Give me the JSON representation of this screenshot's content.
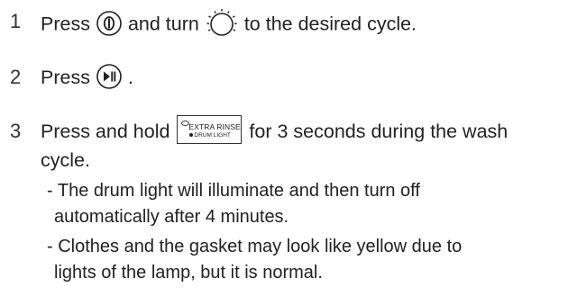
{
  "steps": [
    {
      "number": "1",
      "text_before": "Press",
      "text_middle": "and turn",
      "text_after": "to the desired cycle."
    },
    {
      "number": "2",
      "text_before": "Press",
      "text_after": "."
    },
    {
      "number": "3",
      "text_before": "Press and hold",
      "text_after": "for 3 seconds during the wash",
      "text_cont": "cycle.",
      "button": {
        "line1": "EXTRA RINSE",
        "line2": "DRUM LIGHT"
      },
      "notes": [
        {
          "line1": "- The drum light will illuminate and then turn off",
          "line2": "automatically after 4 minutes."
        },
        {
          "line1": "- Clothes and the gasket may look like yellow due to",
          "line2": "lights of the lamp, but it is normal."
        }
      ]
    }
  ],
  "icons": {
    "power": "power-button-icon",
    "dial": "cycle-dial-icon",
    "play": "start-pause-button-icon"
  }
}
